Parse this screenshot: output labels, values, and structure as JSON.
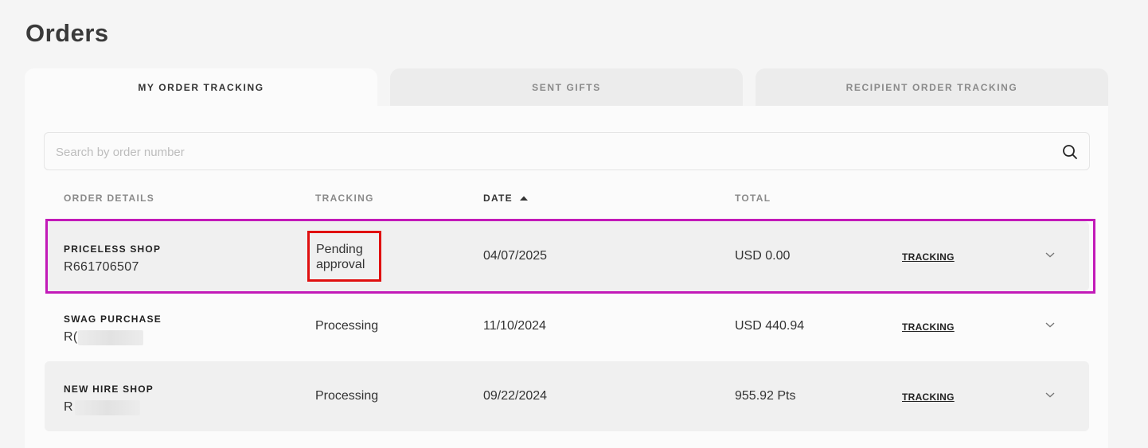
{
  "page": {
    "title": "Orders"
  },
  "tabs": [
    {
      "label": "MY ORDER TRACKING",
      "active": true
    },
    {
      "label": "SENT GIFTS",
      "active": false
    },
    {
      "label": "RECIPIENT ORDER TRACKING",
      "active": false
    }
  ],
  "search": {
    "placeholder": "Search by order number",
    "value": ""
  },
  "table": {
    "headers": {
      "order_details": "ORDER DETAILS",
      "tracking": "TRACKING",
      "date": "DATE",
      "total": "TOTAL"
    },
    "rows": [
      {
        "shop": "PRICELESS SHOP",
        "order_number": "R661706507",
        "status": "Pending approval",
        "date": "04/07/2025",
        "total": "USD 0.00",
        "link": "TRACKING"
      },
      {
        "shop": "SWAG PURCHASE",
        "order_number": "R(",
        "status": "Processing",
        "date": "11/10/2024",
        "total": "USD 440.94",
        "link": "TRACKING"
      },
      {
        "shop": "NEW HIRE SHOP",
        "order_number": "R",
        "status": "Processing",
        "date": "09/22/2024",
        "total": "955.92 Pts",
        "link": "TRACKING"
      }
    ]
  },
  "colors": {
    "highlight_row": "#c21ab8",
    "highlight_status": "#e01010"
  }
}
